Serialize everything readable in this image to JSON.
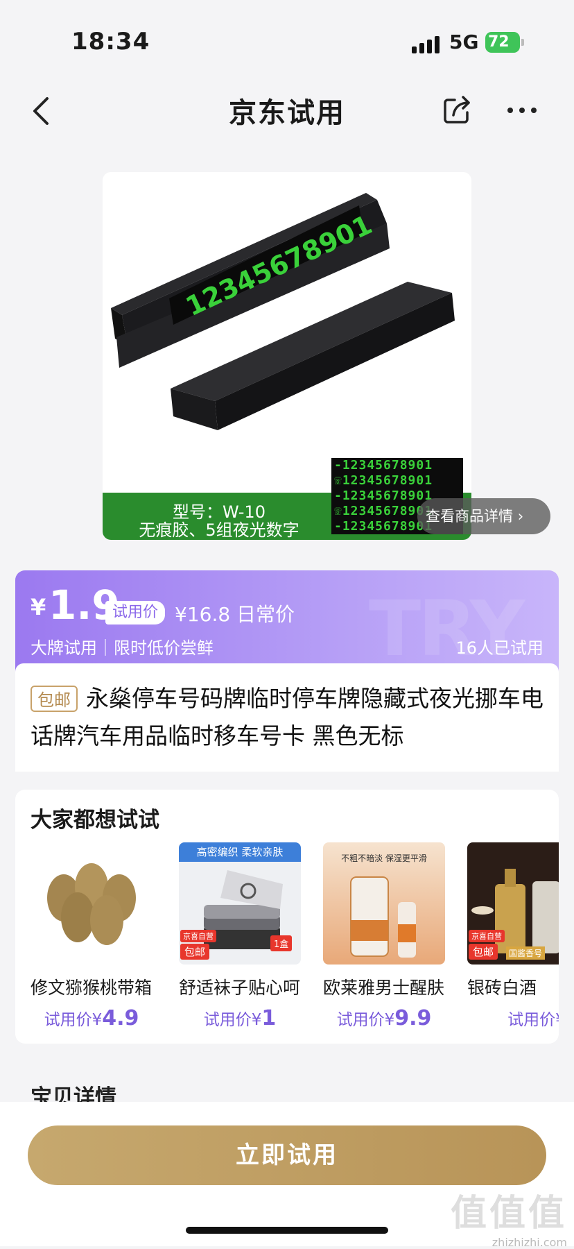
{
  "status_bar": {
    "time": "18:34",
    "network": "5G",
    "battery": "72"
  },
  "nav": {
    "title": "京东试用"
  },
  "product_image": {
    "model_line": "型号：W-10",
    "feature_line": "无痕胶、5组夜光数字",
    "phone_digits": "12345678901",
    "digit_rows": [
      "-12345678901",
      "☏12345678901",
      "-12345678901",
      "☏12345678901",
      "-12345678901"
    ],
    "detail_link": "查看商品详情"
  },
  "price": {
    "currency": "¥",
    "trial_price": "1.9",
    "trial_badge": "试用价",
    "regular_price": "¥16.8 日常价",
    "tagline": "大牌试用｜限时低价尝鲜",
    "tried_count": "16人已试用",
    "watermark": "TRY"
  },
  "product": {
    "badge": "包邮",
    "title": "永燊停车号码牌临时停车牌隐藏式夜光挪车电话牌汽车用品临时移车号卡 黑色无标"
  },
  "recommendations": {
    "title": "大家都想试试",
    "items": [
      {
        "name": "修文猕猴桃带箱",
        "price_label": "试用价¥",
        "price": "4.9"
      },
      {
        "name": "舒适袜子贴心呵",
        "price_label": "试用价¥",
        "price": "1",
        "banner": "高密编织 柔软亲肤",
        "tag1": "京喜自营",
        "tag2": "包邮",
        "tag3": "1盒"
      },
      {
        "name": "欧莱雅男士醒肤",
        "price_label": "试用价¥",
        "price": "9.9",
        "banner": "不粗不暗淡 保湿更平滑"
      },
      {
        "name": "银砖白酒",
        "price_label": "试用价¥",
        "price": "",
        "tag1": "京喜自营",
        "tag2": "包邮",
        "tag3": "国酱香号"
      }
    ]
  },
  "section_peek": "宝贝详情",
  "cta": {
    "label": "立即试用"
  },
  "site_watermark": {
    "logo": "值值值",
    "url": "zhizhizhi.com"
  },
  "colors": {
    "accent_purple": "#9b79f0",
    "gold": "#c6a86e",
    "glow_green": "#3ad13a"
  }
}
